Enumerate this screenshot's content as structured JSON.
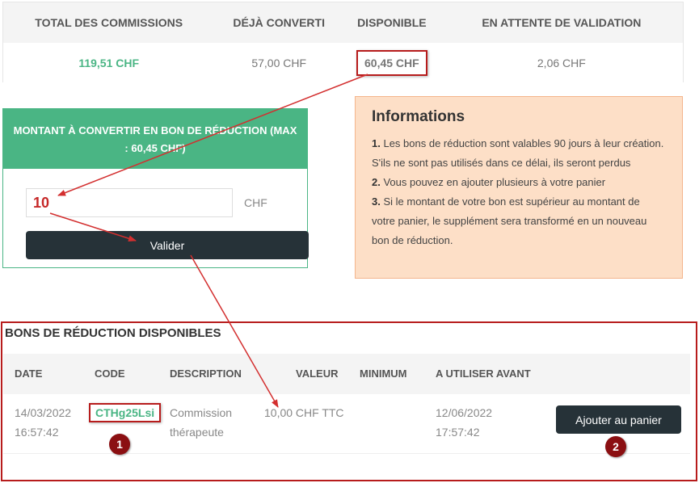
{
  "summary": {
    "headers": [
      "TOTAL DES COMMISSIONS",
      "DÉJÀ CONVERTI",
      "DISPONIBLE",
      "EN ATTENTE DE VALIDATION"
    ],
    "values": [
      "119,51 CHF",
      "57,00 CHF",
      "60,45 CHF",
      "2,06 CHF"
    ]
  },
  "convert": {
    "title": "MONTANT À CONVERTIR EN BON DE RÉDUCTION (MAX : 60,45 CHF)",
    "amount_value": "10",
    "currency": "CHF",
    "validate_label": "Valider"
  },
  "info": {
    "title": "Informations",
    "items": [
      {
        "num": "1.",
        "text": "Les bons de réduction sont valables 90 jours à leur création. S'ils ne sont pas utilisés dans ce délai, ils seront perdus"
      },
      {
        "num": "2.",
        "text": "Vous pouvez en ajouter plusieurs à votre panier"
      },
      {
        "num": "3.",
        "text": "Si le montant de votre bon est supérieur au montant de votre panier, le supplément sera transformé en un nouveau bon de réduction."
      }
    ]
  },
  "vouchers": {
    "title": "BONS DE RÉDUCTION DISPONIBLES",
    "headers": {
      "date": "DATE",
      "code": "CODE",
      "description": "DESCRIPTION",
      "value": "VALEUR",
      "minimum": "MINIMUM",
      "use_before": "A UTILISER AVANT"
    },
    "rows": [
      {
        "date_line1": "14/03/2022",
        "date_line2": "16:57:42",
        "code": "CTHg25Lsi",
        "description_line1": "Commission",
        "description_line2": "thérapeute",
        "value": "10,00 CHF TTC",
        "minimum": "",
        "use_before_line1": "12/06/2022",
        "use_before_line2": "17:57:42",
        "add_label": "Ajouter au panier"
      }
    ]
  },
  "badges": [
    "1",
    "2"
  ],
  "colors": {
    "accent_green": "#4ab584",
    "annotation_red": "#b71c1c",
    "dark_button": "#263238",
    "info_bg": "#fddfc7"
  }
}
